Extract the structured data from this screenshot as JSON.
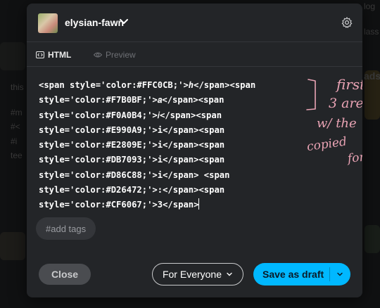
{
  "background": {
    "left_texts": [
      "this",
      "#m",
      "#<",
      "#i",
      "tee"
    ],
    "right_texts": [
      "log",
      "lass",
      "ads"
    ]
  },
  "modal": {
    "blog_name": "elysian-fawn",
    "tabs": [
      {
        "label": "HTML",
        "active": true
      },
      {
        "label": "Preview",
        "active": false
      }
    ],
    "code_lines": [
      "<span style='color:#FFC0CB;'>ℎ</span><span",
      "style='color:#F7B0BF;'>𝑎</span><span",
      "style='color:#F0A0B4;'>𝑖</span><span",
      "style='color:#E990A9;'>i</span><span",
      "style='color:#E2809E;'>i</span><span",
      "style='color:#DB7093;'>i</span><span",
      "style='color:#D86C88;'>i</span> <span",
      "style='color:#D26472;'>:</span><span",
      "style='color:#CF6067;'>3</span>"
    ],
    "annotation": [
      "first",
      "3 are",
      "w/ the",
      "copied",
      "font"
    ],
    "tags_placeholder": "#add tags",
    "footer": {
      "close_label": "Close",
      "audience_label": "For Everyone",
      "save_label": "Save as draft"
    }
  },
  "colors": {
    "accent": "#00b8ff",
    "annotation_ink": "#e9a3b4",
    "modal_bg": "#232528"
  }
}
